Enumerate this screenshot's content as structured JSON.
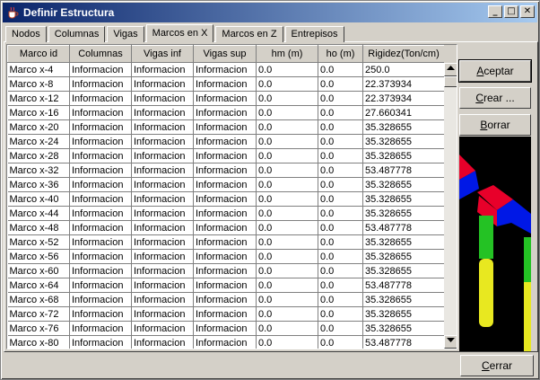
{
  "window": {
    "title": "Definir Estructura",
    "controls": {
      "minimize": "_",
      "maximize": "□",
      "close": "✕"
    }
  },
  "tabs": [
    {
      "label": "Nodos",
      "active": false
    },
    {
      "label": "Columnas",
      "active": false
    },
    {
      "label": "Vigas",
      "active": false
    },
    {
      "label": "Marcos en X",
      "active": true
    },
    {
      "label": "Marcos en Z",
      "active": false
    },
    {
      "label": "Entrepisos",
      "active": false
    }
  ],
  "table": {
    "columns": [
      "Marco id",
      "Columnas",
      "Vigas inf",
      "Vigas sup",
      "hm (m)",
      "ho (m)",
      "Rigidez(Ton/cm)"
    ],
    "rows": [
      [
        "Marco x-4",
        "Informacion",
        "Informacion",
        "Informacion",
        "0.0",
        "0.0",
        "250.0"
      ],
      [
        "Marco x-8",
        "Informacion",
        "Informacion",
        "Informacion",
        "0.0",
        "0.0",
        "22.373934"
      ],
      [
        "Marco x-12",
        "Informacion",
        "Informacion",
        "Informacion",
        "0.0",
        "0.0",
        "22.373934"
      ],
      [
        "Marco x-16",
        "Informacion",
        "Informacion",
        "Informacion",
        "0.0",
        "0.0",
        "27.660341"
      ],
      [
        "Marco x-20",
        "Informacion",
        "Informacion",
        "Informacion",
        "0.0",
        "0.0",
        "35.328655"
      ],
      [
        "Marco x-24",
        "Informacion",
        "Informacion",
        "Informacion",
        "0.0",
        "0.0",
        "35.328655"
      ],
      [
        "Marco x-28",
        "Informacion",
        "Informacion",
        "Informacion",
        "0.0",
        "0.0",
        "35.328655"
      ],
      [
        "Marco x-32",
        "Informacion",
        "Informacion",
        "Informacion",
        "0.0",
        "0.0",
        "53.487778"
      ],
      [
        "Marco x-36",
        "Informacion",
        "Informacion",
        "Informacion",
        "0.0",
        "0.0",
        "35.328655"
      ],
      [
        "Marco x-40",
        "Informacion",
        "Informacion",
        "Informacion",
        "0.0",
        "0.0",
        "35.328655"
      ],
      [
        "Marco x-44",
        "Informacion",
        "Informacion",
        "Informacion",
        "0.0",
        "0.0",
        "35.328655"
      ],
      [
        "Marco x-48",
        "Informacion",
        "Informacion",
        "Informacion",
        "0.0",
        "0.0",
        "53.487778"
      ],
      [
        "Marco x-52",
        "Informacion",
        "Informacion",
        "Informacion",
        "0.0",
        "0.0",
        "35.328655"
      ],
      [
        "Marco x-56",
        "Informacion",
        "Informacion",
        "Informacion",
        "0.0",
        "0.0",
        "35.328655"
      ],
      [
        "Marco x-60",
        "Informacion",
        "Informacion",
        "Informacion",
        "0.0",
        "0.0",
        "35.328655"
      ],
      [
        "Marco x-64",
        "Informacion",
        "Informacion",
        "Informacion",
        "0.0",
        "0.0",
        "53.487778"
      ],
      [
        "Marco x-68",
        "Informacion",
        "Informacion",
        "Informacion",
        "0.0",
        "0.0",
        "35.328655"
      ],
      [
        "Marco x-72",
        "Informacion",
        "Informacion",
        "Informacion",
        "0.0",
        "0.0",
        "35.328655"
      ],
      [
        "Marco x-76",
        "Informacion",
        "Informacion",
        "Informacion",
        "0.0",
        "0.0",
        "35.328655"
      ],
      [
        "Marco x-80",
        "Informacion",
        "Informacion",
        "Informacion",
        "0.0",
        "0.0",
        "53.487778"
      ]
    ]
  },
  "buttons": {
    "accept": {
      "mnemonic": "A",
      "rest": "ceptar"
    },
    "create": {
      "mnemonic": "C",
      "rest": "rear ..."
    },
    "delete": {
      "mnemonic": "B",
      "rest": "orrar"
    },
    "close": {
      "mnemonic": "C",
      "rest": "errar"
    }
  },
  "preview_colors": {
    "background": "#000000",
    "red": "#e8002a",
    "blue": "#0018e6",
    "green": "#24c224",
    "yellow": "#e8e820"
  }
}
